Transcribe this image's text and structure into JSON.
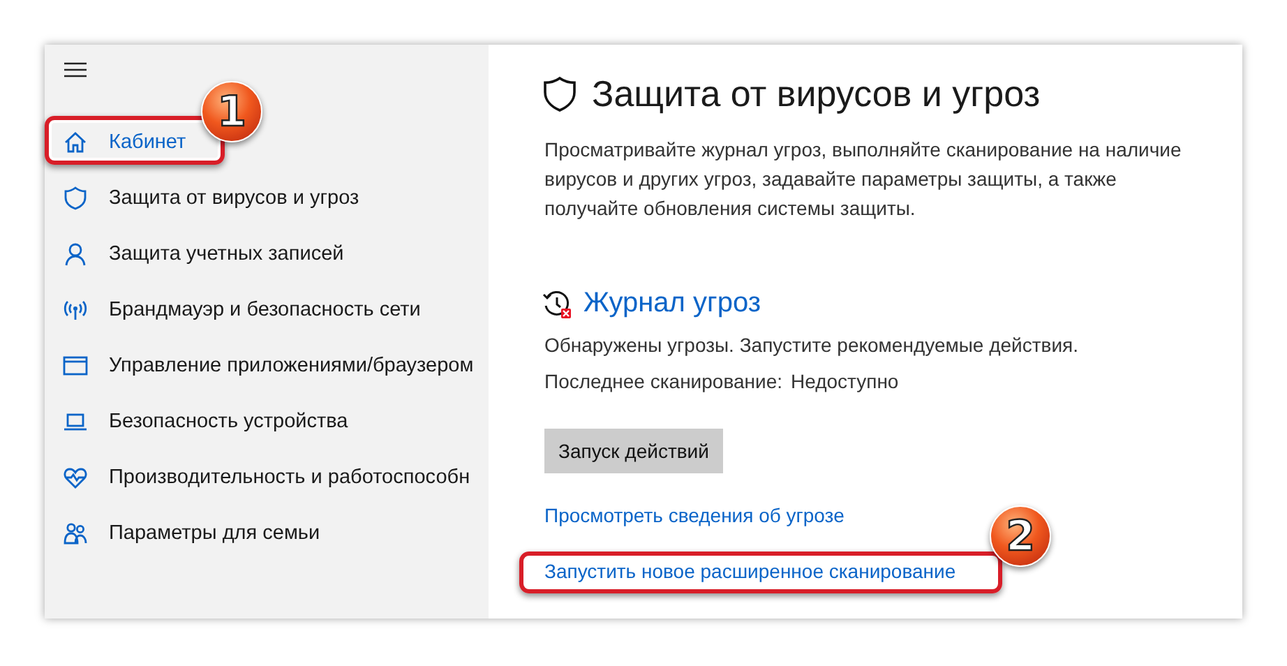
{
  "sidebar": {
    "items": [
      {
        "label": "Кабинет",
        "kind": "home",
        "selected": true
      },
      {
        "label": "Защита от вирусов и угроз",
        "kind": "shield",
        "selected": false
      },
      {
        "label": "Защита учетных записей",
        "kind": "person",
        "selected": false
      },
      {
        "label": "Брандмауэр и безопасность сети",
        "kind": "antenna",
        "selected": false
      },
      {
        "label": "Управление приложениями/браузером",
        "kind": "window",
        "selected": false
      },
      {
        "label": "Безопасность устройства",
        "kind": "laptop",
        "selected": false
      },
      {
        "label": "Производительность и работоспособн",
        "kind": "heart",
        "selected": false
      },
      {
        "label": "Параметры для семьи",
        "kind": "family",
        "selected": false
      }
    ]
  },
  "page": {
    "title": "Защита от вирусов и угроз",
    "description": "Просматривайте журнал угроз, выполняйте сканирование на наличие вирусов и других угроз, задавайте параметры защиты, а также получайте обновления системы защиты.",
    "section": {
      "title": "Журнал угроз",
      "status": "Обнаружены угрозы. Запустите рекомендуемые действия.",
      "last_scan_label": "Последнее сканирование:",
      "last_scan_value": "Недоступно",
      "button": "Запуск действий",
      "links": [
        "Просмотреть сведения об угрозе",
        "Запустить новое расширенное сканирование"
      ]
    }
  },
  "callouts": [
    {
      "number": "1"
    },
    {
      "number": "2"
    }
  ]
}
